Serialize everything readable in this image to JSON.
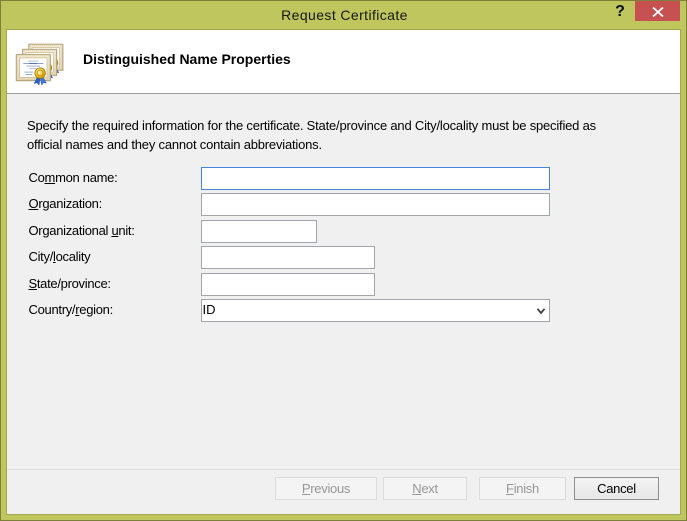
{
  "window": {
    "title": "Request Certificate",
    "help_glyph": "?"
  },
  "header": {
    "title": "Distinguished Name Properties",
    "icon": "certificates-icon"
  },
  "instructions": {
    "line1": "Specify the required information for the certificate. State/province and City/locality must be specified as",
    "line2": "official names and they cannot contain abbreviations."
  },
  "form": {
    "fields": [
      {
        "label_pre": "Co",
        "label_key": "m",
        "label_post": "mon name:",
        "value": "",
        "type": "text",
        "focused": true
      },
      {
        "label_pre": "",
        "label_key": "O",
        "label_post": "rganization:",
        "value": "",
        "type": "text",
        "focused": false
      },
      {
        "label_pre": "Organizational ",
        "label_key": "u",
        "label_post": "nit:",
        "value": "",
        "type": "text",
        "focused": false
      },
      {
        "label_pre": "City/",
        "label_key": "l",
        "label_post": "ocality",
        "value": "",
        "type": "text",
        "focused": false
      },
      {
        "label_pre": "",
        "label_key": "S",
        "label_post": "tate/province:",
        "value": "",
        "type": "text",
        "focused": false
      },
      {
        "label_pre": "Country/",
        "label_key": "r",
        "label_post": "egion:",
        "value": "ID",
        "type": "combo",
        "focused": false
      }
    ]
  },
  "buttons": {
    "previous": {
      "pre": "",
      "key": "P",
      "post": "revious",
      "disabled": true
    },
    "next": {
      "pre": "",
      "key": "N",
      "post": "ext",
      "disabled": true
    },
    "finish": {
      "pre": "",
      "key": "F",
      "post": "inish",
      "disabled": true
    },
    "cancel": {
      "pre": "Cancel",
      "key": "",
      "post": "",
      "disabled": false
    }
  },
  "colors": {
    "frame": "#c0c65e",
    "frame_border": "#7d8038",
    "close_button": "#c75050",
    "body_bg": "#f0f0f0",
    "header_bg": "#ffffff",
    "focus_border": "#4484dc"
  }
}
